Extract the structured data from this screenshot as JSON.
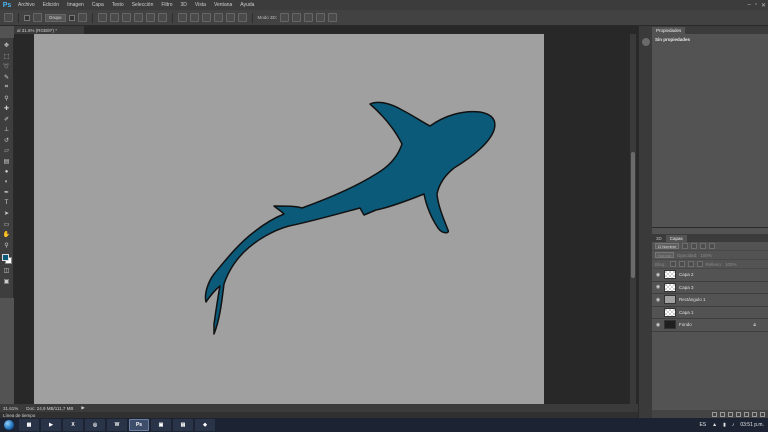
{
  "menubar": {
    "logo": "Ps",
    "items": [
      "Archivo",
      "Edición",
      "Imagen",
      "Capa",
      "Texto",
      "Selección",
      "Filtro",
      "3D",
      "Vista",
      "Ventana",
      "Ayuda"
    ]
  },
  "options": {
    "mode_select": "Grupo",
    "mode_3d": "Modo 3D:"
  },
  "document": {
    "tab_title": "al 31.6% (RGB/8*) *",
    "zoom": "31.61%",
    "doc_info": "Doc: 24,9 MB/111,7 MB"
  },
  "panels": {
    "top_tabs": [
      "Propiedades"
    ],
    "properties_title": "Sin propiedades",
    "layers_tabs": [
      "3D",
      "Capas"
    ],
    "filter_kind": "Ω Nombre",
    "blend_mode": "Normal",
    "opacity_label": "Opacidad:",
    "opacity_value": "100%",
    "lock_label": "Bloq.:",
    "fill_label": "Relleno:",
    "fill_value": "100%",
    "layers": [
      {
        "name": "Capa 2",
        "thumb": "checker",
        "visible": true
      },
      {
        "name": "Capa 3",
        "thumb": "checker",
        "visible": true
      },
      {
        "name": "Rectángulo 1",
        "thumb": "gray",
        "visible": true
      },
      {
        "name": "Capa 1",
        "thumb": "checker",
        "visible": false
      },
      {
        "name": "Fondo",
        "thumb": "dark",
        "visible": true
      }
    ]
  },
  "timeline_label": "Línea de tiempo",
  "taskbar": {
    "app_label": "Ps",
    "lang": "ES",
    "time": "03:51 p.m."
  },
  "colors": {
    "foreground": "#0b5a7a",
    "shark_fill": "#0b5a7a",
    "canvas_bg": "#a0a0a0"
  }
}
